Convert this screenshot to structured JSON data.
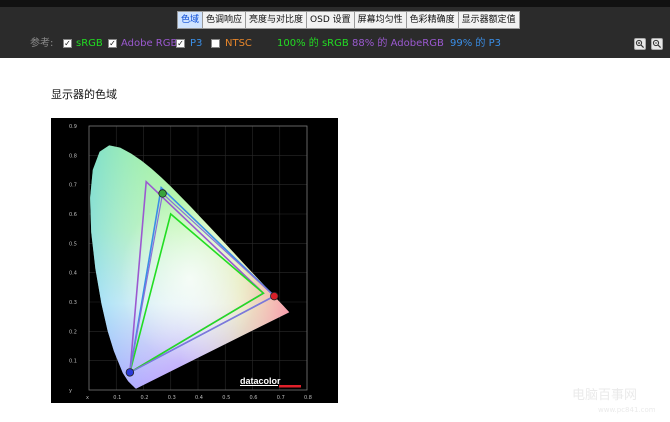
{
  "toolbar": {
    "tabs": [
      {
        "label": "色域",
        "active": true
      },
      {
        "label": "色调响应",
        "active": false
      },
      {
        "label": "亮度与对比度",
        "active": false
      },
      {
        "label": "OSD 设置",
        "active": false
      },
      {
        "label": "屏幕均匀性",
        "active": false
      },
      {
        "label": "色彩精确度",
        "active": false
      },
      {
        "label": "显示器额定值",
        "active": false
      }
    ]
  },
  "reference": {
    "label": "参考:",
    "options": [
      {
        "name": "sRGB",
        "checked": true,
        "color": "#22dd22"
      },
      {
        "name": "Adobe RGB",
        "checked": true,
        "color": "#9b59d0"
      },
      {
        "name": "P3",
        "checked": true,
        "color": "#3a8ee6"
      },
      {
        "name": "NTSC",
        "checked": false,
        "color": "#e8862a"
      }
    ],
    "stats": [
      {
        "value": "100%",
        "of": "的",
        "space": "sRGB",
        "color": "#22dd22"
      },
      {
        "value": "88%",
        "of": "的",
        "space": "AdobeRGB",
        "color": "#9b59d0"
      },
      {
        "value": "99%",
        "of": "的",
        "space": "P3",
        "color": "#3a8ee6"
      }
    ],
    "zoom_in_icon": "zoom-in-icon",
    "zoom_out_icon": "zoom-out-icon"
  },
  "section": {
    "title": "显示器的色域"
  },
  "gamut_chart": {
    "y_ticks": [
      "0.9",
      "0.8",
      "0.7",
      "0.6",
      "0.5",
      "0.4",
      "0.3",
      "0.2",
      "0.1",
      "y"
    ],
    "x_ticks": [
      "x",
      "0.1",
      "0.2",
      "0.3",
      "0.4",
      "0.5",
      "0.6",
      "0.7",
      "0.8"
    ],
    "logo": "datacolor",
    "triangles": {
      "adobe_rgb": [
        [
          0.64,
          0.33
        ],
        [
          0.21,
          0.71
        ],
        [
          0.15,
          0.06
        ]
      ],
      "p3": [
        [
          0.68,
          0.32
        ],
        [
          0.265,
          0.69
        ],
        [
          0.15,
          0.06
        ]
      ],
      "srgb": [
        [
          0.64,
          0.33
        ],
        [
          0.3,
          0.6
        ],
        [
          0.15,
          0.06
        ]
      ],
      "measured": [
        [
          0.68,
          0.32
        ],
        [
          0.27,
          0.67
        ],
        [
          0.15,
          0.06
        ]
      ]
    },
    "colors": {
      "adobe_rgb": "#9b59d0",
      "p3": "#3a8ee6",
      "srgb": "#22dd22"
    }
  },
  "watermark": {
    "main": "电脑百事网",
    "url": "www.pc841.com"
  }
}
